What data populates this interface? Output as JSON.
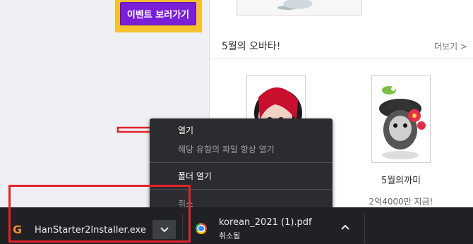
{
  "event_button": {
    "label": "이벤트 보러가기"
  },
  "section": {
    "title": "5월의 오바타!",
    "more_label": "더보기 >"
  },
  "character": {
    "name": "5월의까미",
    "price": "2억4000만 지금!"
  },
  "context_menu": {
    "items": [
      {
        "label": "열기",
        "dim": false
      },
      {
        "label": "해당 유형의 파일 항상 열기",
        "dim": true
      },
      {
        "label": "폴더 열기",
        "dim": false
      },
      {
        "label": "취소",
        "dim": true
      }
    ]
  },
  "downloads": {
    "item1": {
      "icon": "G",
      "filename": "HanStarter2Installer.exe"
    },
    "item2": {
      "filename": "korean_2021 (1).pdf",
      "status": "취소됨"
    }
  },
  "colors": {
    "annotation_red": "#e3222b",
    "event_purple": "#7a1fd6",
    "event_yellow": "#f6c12f"
  }
}
